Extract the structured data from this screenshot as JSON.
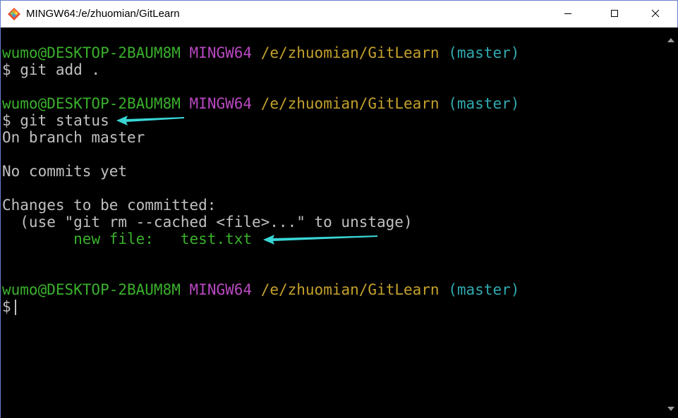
{
  "window": {
    "title": "MINGW64:/e/zhuomian/GitLearn",
    "controls": {
      "minimize_icon": "minimize-icon",
      "maximize_icon": "maximize-icon",
      "close_icon": "close-icon"
    }
  },
  "terminal": {
    "prompt1": {
      "user": "wumo@DESKTOP-2BAUM8M",
      "env": "MINGW64",
      "path": "/e/zhuomian/GitLearn",
      "branch": "(master)"
    },
    "cmd1": "$ git add .",
    "prompt2": {
      "user": "wumo@DESKTOP-2BAUM8M",
      "env": "MINGW64",
      "path": "/e/zhuomian/GitLearn",
      "branch": "(master)"
    },
    "cmd2": "$ git status",
    "out1": "On branch master",
    "out2": "No commits yet",
    "out3": "Changes to be committed:",
    "out4": "  (use \"git rm --cached <file>...\" to unstage)",
    "out5_label": "new file:",
    "out5_file": "test.txt",
    "prompt3": {
      "user": "wumo@DESKTOP-2BAUM8M",
      "env": "MINGW64",
      "path": "/e/zhuomian/GitLearn",
      "branch": "(master)"
    },
    "cmd3": "$"
  },
  "colors": {
    "titlebar": "#ffffff",
    "user": "#3ab02c",
    "env": "#b848c0",
    "path": "#c3a12c",
    "branch": "#30aab0",
    "text": "#c0c0c0",
    "annotation_arrow": "#39d6d6"
  }
}
